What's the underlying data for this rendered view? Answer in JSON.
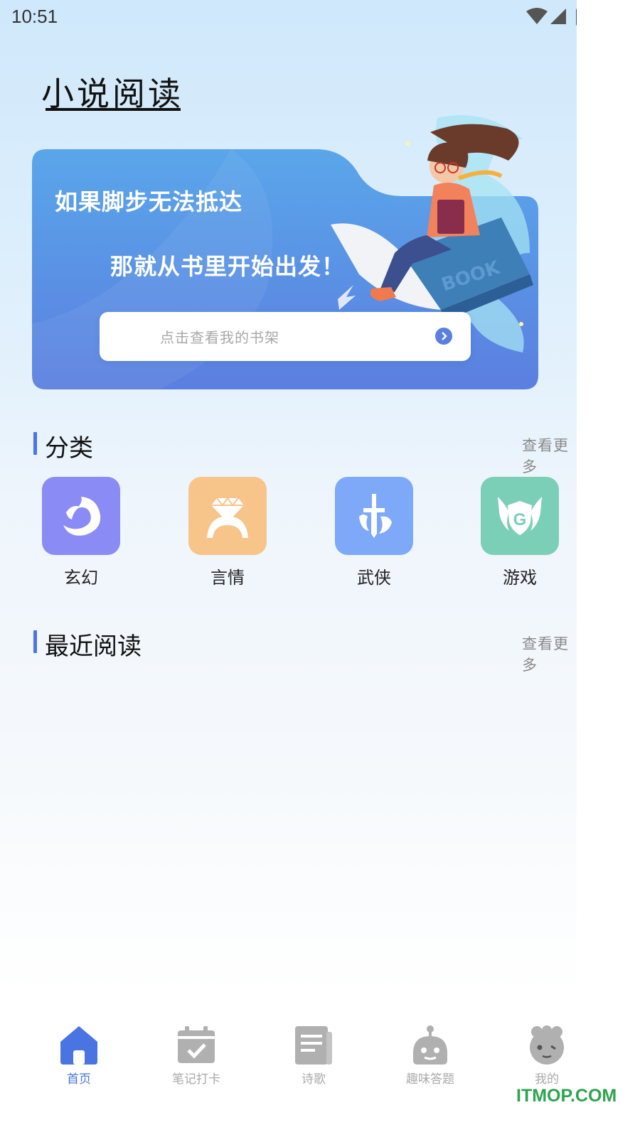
{
  "status_bar": {
    "time": "10:51"
  },
  "app_title": "小说阅读",
  "banner": {
    "line1": "如果脚步无法抵达",
    "line2": "那就从书里开始出发！",
    "book_cover_text": "BOOK",
    "shelf_button": {
      "label": "点击查看我的书架"
    }
  },
  "categories_section": {
    "title": "分类",
    "see_more": "查看更多",
    "items": [
      {
        "label": "玄幻",
        "color": "#8b8bf5",
        "icon": "phoenix-icon"
      },
      {
        "label": "言情",
        "color": "#f7c48a",
        "icon": "diamond-ring-icon"
      },
      {
        "label": "武侠",
        "color": "#7ea8f8",
        "icon": "sword-icon"
      },
      {
        "label": "游戏",
        "color": "#7ccfb7",
        "icon": "winged-shield-icon",
        "icon_letter": "G"
      }
    ]
  },
  "recent_section": {
    "title": "最近阅读",
    "see_more": "查看更多"
  },
  "bottom_nav": {
    "items": [
      {
        "label": "首页",
        "icon": "home-icon",
        "active": true
      },
      {
        "label": "笔记打卡",
        "icon": "calendar-check-icon",
        "active": false
      },
      {
        "label": "诗歌",
        "icon": "document-icon",
        "active": false
      },
      {
        "label": "趣味答题",
        "icon": "robot-icon",
        "active": false
      },
      {
        "label": "我的",
        "icon": "bear-face-icon",
        "active": false
      }
    ]
  },
  "watermark": "ITMOP.COM",
  "colors": {
    "accent": "#4a74e2",
    "inactive": "#a9a9a9",
    "banner_top": "#5aa6ea",
    "banner_bottom": "#5b7fe0"
  }
}
